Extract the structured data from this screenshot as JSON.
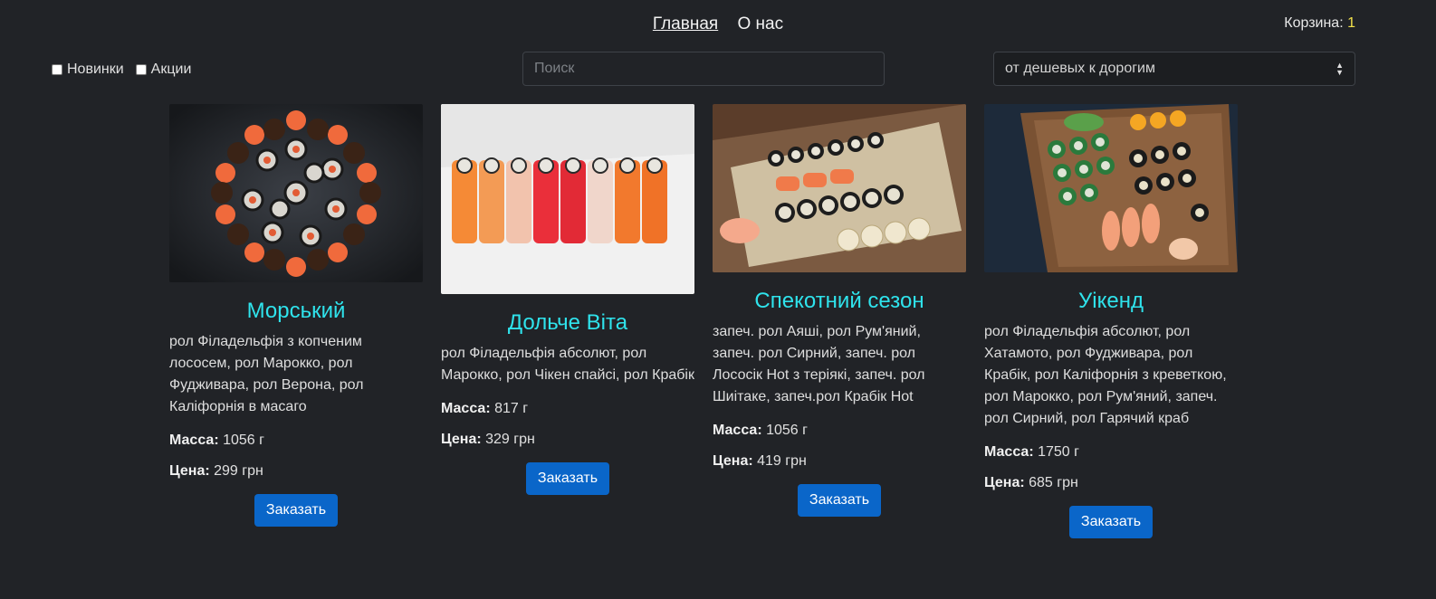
{
  "nav": {
    "home": "Главная",
    "about": "О нас"
  },
  "cart": {
    "label": "Корзина: ",
    "count": "1"
  },
  "filters": {
    "new": "Новинки",
    "sale": "Акции"
  },
  "search": {
    "placeholder": "Поиск"
  },
  "sort": {
    "selected": "от дешевых к дорогим"
  },
  "labels": {
    "mass": "Масса:",
    "price": "Цена:",
    "order": "Заказать"
  },
  "products": [
    {
      "name": "Морський",
      "desc": "рол Філадельфія з копченим лососем, рол Марокко, рол Фудживара, рол Верона, рол Каліфорнія в масаго",
      "mass": "1056 г",
      "price": "299 грн"
    },
    {
      "name": "Дольче Віта",
      "desc": "рол Філадельфія абсолют, рол Марокко, рол Чікен спайсі, рол Крабік",
      "mass": "817 г",
      "price": "329 грн"
    },
    {
      "name": "Спекотний сезон",
      "desc": "запеч. рол Аяші, рол Рум'яний, запеч. рол Сирний, запеч. рол Лососік Hot з теріякі, запеч. рол Шиітаке, запеч.рол Крабік Hot",
      "mass": "1056 г",
      "price": "419 грн"
    },
    {
      "name": "Уікенд",
      "desc": "рол Філадельфія абсолют, рол Хатамото, рол Фудживара, рол Крабік, рол Каліфорнія з креветкою, рол Марокко, рол Рум'яний, запеч. рол Сирний, рол Гарячий краб",
      "mass": "1750 г",
      "price": "685 грн"
    }
  ]
}
